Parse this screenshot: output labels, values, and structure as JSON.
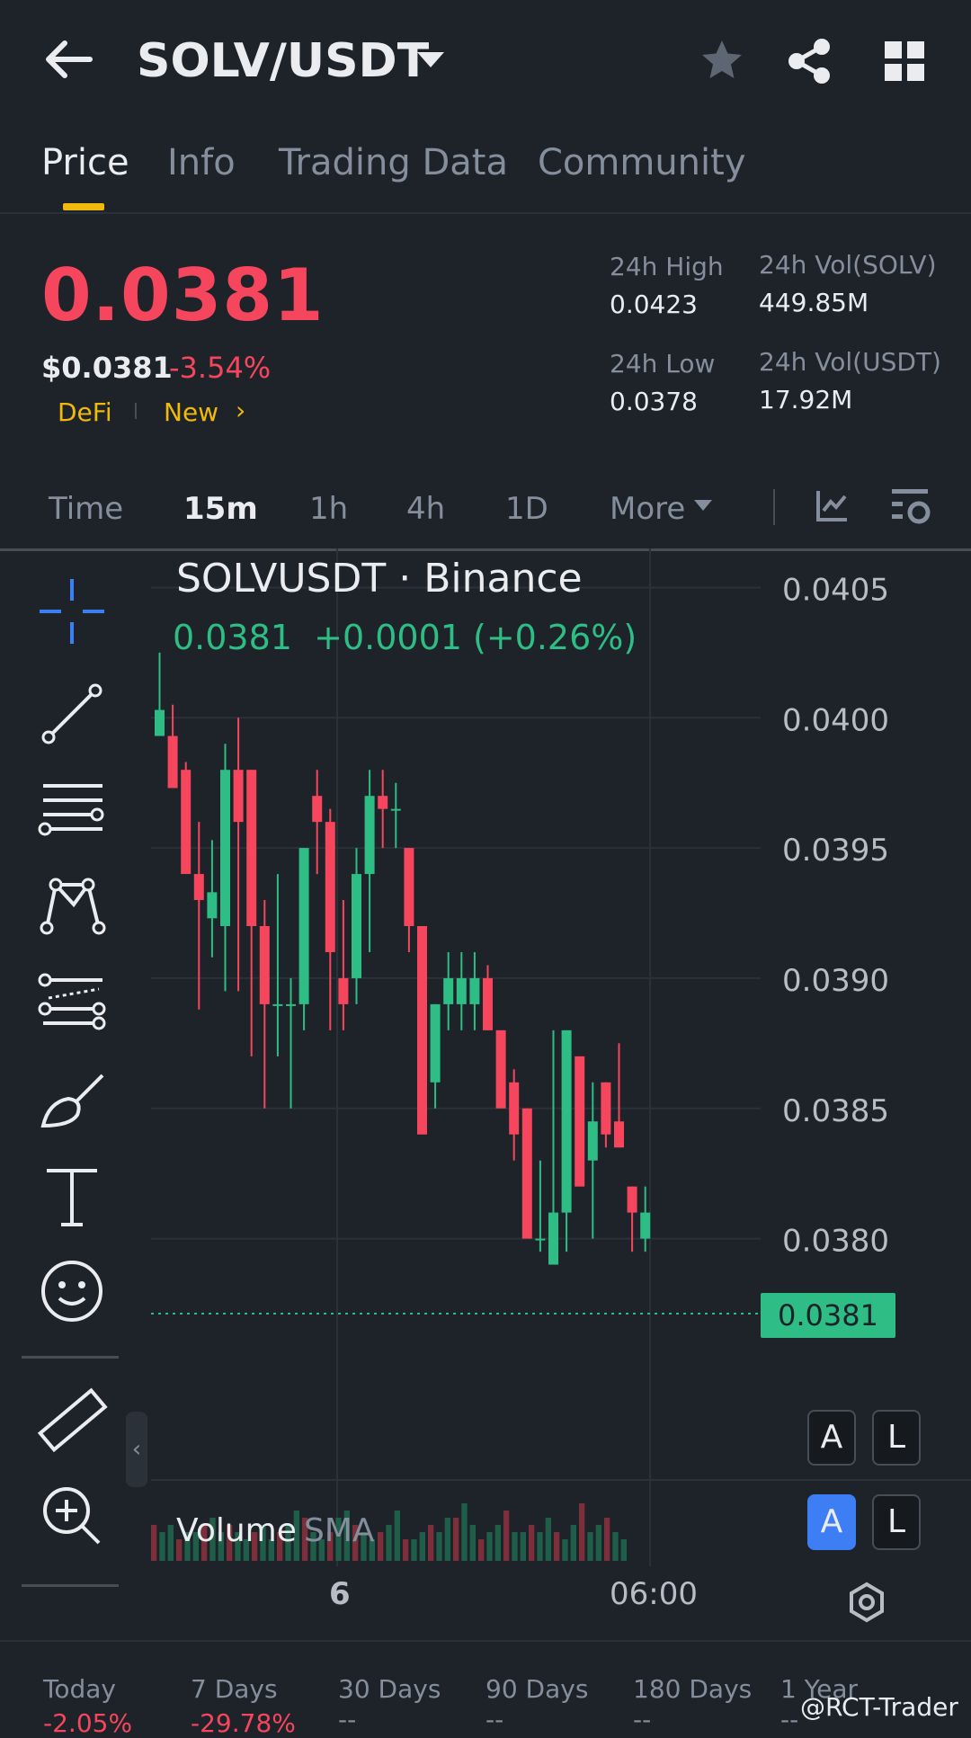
{
  "header": {
    "pair": "SOLV/USDT",
    "icons": [
      "back-arrow-icon",
      "caret-down-icon",
      "star-icon",
      "share-icon",
      "grid-icon"
    ]
  },
  "tabs": [
    "Price",
    "Info",
    "Trading Data",
    "Community"
  ],
  "price": {
    "last": "0.0381",
    "usd": "$0.0381",
    "change_pct": "-3.54%",
    "tags": [
      "DeFi",
      "New"
    ],
    "stats": {
      "high_label": "24h High",
      "high": "0.0423",
      "low_label": "24h Low",
      "low": "0.0378",
      "vol_base_label": "24h Vol(SOLV)",
      "vol_base": "449.85M",
      "vol_quote_label": "24h Vol(USDT)",
      "vol_quote": "17.92M"
    }
  },
  "intervals": [
    "Time",
    "15m",
    "1h",
    "4h",
    "1D",
    "More"
  ],
  "chart": {
    "title": "SOLVUSDT · Binance",
    "ohlc_line": "0.0381  +0.0001 (+0.26%)",
    "volume_label": "Volume",
    "sma_label": "SMA",
    "y_ticks": [
      "0.0405",
      "0.0400",
      "0.0395",
      "0.0390",
      "0.0385",
      "0.0380"
    ],
    "x_ticks": [
      "6",
      "06:00"
    ],
    "last_price_tag": "0.0381",
    "scale_buttons": [
      "A",
      "L"
    ],
    "colors": {
      "up": "#2ebd85",
      "down": "#f6465d",
      "bg": "#1e2329"
    }
  },
  "chart_data": {
    "type": "candlestick",
    "title": "SOLVUSDT · Binance",
    "ylim": [
      0.03775,
      0.04065
    ],
    "candles": [
      {
        "o": 0.03993,
        "h": 0.04025,
        "l": 0.03995,
        "c": 0.04003
      },
      {
        "o": 0.03993,
        "h": 0.04005,
        "l": 0.03975,
        "c": 0.03973
      },
      {
        "o": 0.0398,
        "h": 0.03983,
        "l": 0.03953,
        "c": 0.0394
      },
      {
        "o": 0.0394,
        "h": 0.0396,
        "l": 0.03888,
        "c": 0.0393
      },
      {
        "o": 0.03923,
        "h": 0.03953,
        "l": 0.03908,
        "c": 0.03933
      },
      {
        "o": 0.0392,
        "h": 0.0399,
        "l": 0.03895,
        "c": 0.0398
      },
      {
        "o": 0.0398,
        "h": 0.04,
        "l": 0.03895,
        "c": 0.0396
      },
      {
        "o": 0.0398,
        "h": 0.0398,
        "l": 0.0387,
        "c": 0.0392
      },
      {
        "o": 0.0392,
        "h": 0.0393,
        "l": 0.0385,
        "c": 0.0389
      },
      {
        "o": 0.0389,
        "h": 0.0394,
        "l": 0.0387,
        "c": 0.0389
      },
      {
        "o": 0.0389,
        "h": 0.039,
        "l": 0.0385,
        "c": 0.0389
      },
      {
        "o": 0.0389,
        "h": 0.0395,
        "l": 0.0388,
        "c": 0.0395
      },
      {
        "o": 0.0397,
        "h": 0.0398,
        "l": 0.0394,
        "c": 0.0396
      },
      {
        "o": 0.0396,
        "h": 0.03965,
        "l": 0.0388,
        "c": 0.0391
      },
      {
        "o": 0.039,
        "h": 0.0393,
        "l": 0.0388,
        "c": 0.0389
      },
      {
        "o": 0.039,
        "h": 0.0395,
        "l": 0.0389,
        "c": 0.0394
      },
      {
        "o": 0.0394,
        "h": 0.0398,
        "l": 0.0391,
        "c": 0.0397
      },
      {
        "o": 0.0397,
        "h": 0.0398,
        "l": 0.0395,
        "c": 0.03965
      },
      {
        "o": 0.03965,
        "h": 0.03975,
        "l": 0.0395,
        "c": 0.03965
      },
      {
        "o": 0.0395,
        "h": 0.0395,
        "l": 0.0391,
        "c": 0.0392
      },
      {
        "o": 0.0392,
        "h": 0.0392,
        "l": 0.0384,
        "c": 0.0384
      },
      {
        "o": 0.0386,
        "h": 0.0389,
        "l": 0.0385,
        "c": 0.0389
      },
      {
        "o": 0.0389,
        "h": 0.0391,
        "l": 0.0388,
        "c": 0.039
      },
      {
        "o": 0.0389,
        "h": 0.0391,
        "l": 0.0388,
        "c": 0.039
      },
      {
        "o": 0.0389,
        "h": 0.0391,
        "l": 0.0388,
        "c": 0.039
      },
      {
        "o": 0.039,
        "h": 0.03905,
        "l": 0.0388,
        "c": 0.0388
      },
      {
        "o": 0.0388,
        "h": 0.0388,
        "l": 0.0386,
        "c": 0.0385
      },
      {
        "o": 0.0386,
        "h": 0.03865,
        "l": 0.0383,
        "c": 0.0384
      },
      {
        "o": 0.0385,
        "h": 0.0385,
        "l": 0.0381,
        "c": 0.038
      },
      {
        "o": 0.038,
        "h": 0.0383,
        "l": 0.03795,
        "c": 0.038
      },
      {
        "o": 0.0379,
        "h": 0.0388,
        "l": 0.0379,
        "c": 0.0381
      },
      {
        "o": 0.0381,
        "h": 0.0388,
        "l": 0.03795,
        "c": 0.0388
      },
      {
        "o": 0.0387,
        "h": 0.0387,
        "l": 0.0383,
        "c": 0.0382
      },
      {
        "o": 0.0383,
        "h": 0.0386,
        "l": 0.038,
        "c": 0.03845
      },
      {
        "o": 0.0386,
        "h": 0.0386,
        "l": 0.03835,
        "c": 0.0384
      },
      {
        "o": 0.03845,
        "h": 0.03875,
        "l": 0.03835,
        "c": 0.03835
      },
      {
        "o": 0.0382,
        "h": 0.0382,
        "l": 0.03795,
        "c": 0.0381
      },
      {
        "o": 0.038,
        "h": 0.0382,
        "l": 0.03795,
        "c": 0.0381
      }
    ],
    "volume": [
      5,
      4,
      5,
      3,
      4,
      4,
      5,
      6,
      4,
      5,
      4,
      3,
      4,
      5,
      3,
      4,
      5,
      7,
      6,
      4,
      3,
      4,
      6,
      7,
      5,
      4,
      3,
      4,
      5,
      7,
      3,
      3,
      4,
      5,
      4,
      6,
      6,
      8,
      5,
      3,
      4,
      5,
      7,
      4,
      4,
      5,
      4,
      6,
      4,
      3,
      5,
      8,
      4,
      5,
      6,
      4,
      3
    ]
  },
  "perf": [
    {
      "label": "Today",
      "value": "-2.05%"
    },
    {
      "label": "7 Days",
      "value": "-29.78%"
    },
    {
      "label": "30 Days",
      "value": "--"
    },
    {
      "label": "90 Days",
      "value": "--"
    },
    {
      "label": "180 Days",
      "value": "--"
    },
    {
      "label": "1 Year",
      "value": "--"
    }
  ],
  "watermark": "@RCT-Trader"
}
